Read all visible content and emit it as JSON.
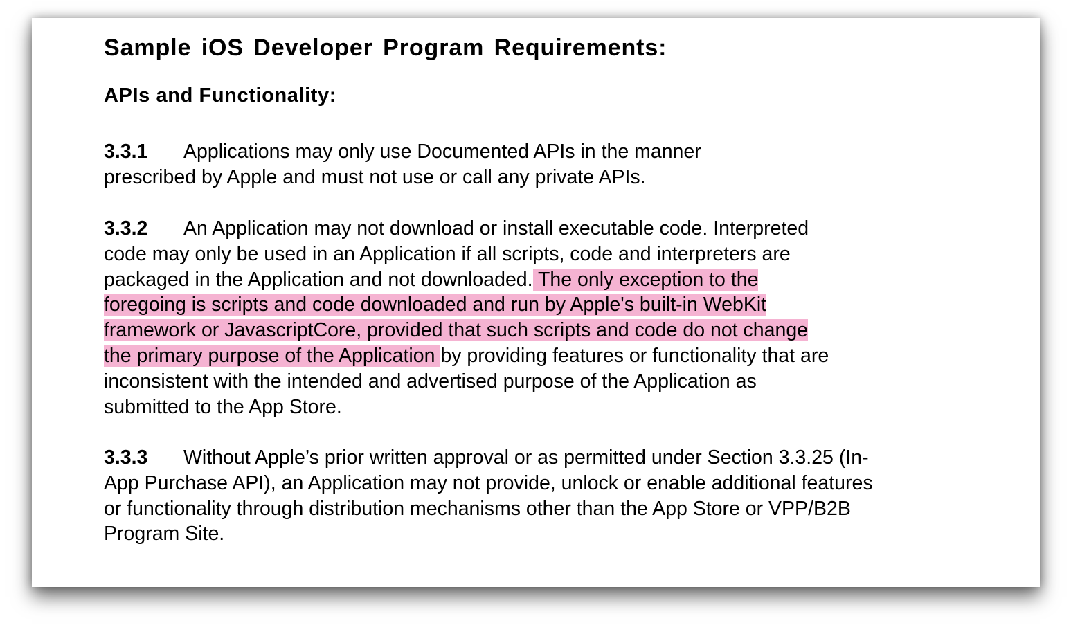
{
  "title": "Sample iOS Developer Program Requirements:",
  "subtitle": "APIs and Functionality:",
  "sections": [
    {
      "number": "3.3.1",
      "lines": [
        "Applications may only use Documented APIs in the manner",
        "prescribed by Apple and must not use or call any private APIs."
      ]
    },
    {
      "number": "3.3.2",
      "lines": [
        "An Application may not download or install executable code. Interpreted",
        "code may only be used in an Application if all scripts, code and interpreters are",
        "packaged in the Application and not downloaded.",
        " The only exception to the",
        "foregoing is scripts and code downloaded and run by Apple's built-in WebKit ",
        "framework or JavascriptCore, provided that such scripts and code do not change",
        "the primary purpose of the Application ",
        "by providing features or functionality that are",
        "inconsistent with the intended and advertised purpose of the Application as",
        "submitted to the App Store."
      ]
    },
    {
      "number": "3.3.3",
      "lines": [
        "Without Apple’s prior written approval or as permitted under Section 3.3.25 (In-",
        "App Purchase API), an Application may not provide, unlock or enable additional features",
        "or functionality through distribution mechanisms other than the App Store or VPP/B2B",
        "Program Site."
      ]
    }
  ],
  "colors": {
    "highlight": "#f5b3d2"
  }
}
